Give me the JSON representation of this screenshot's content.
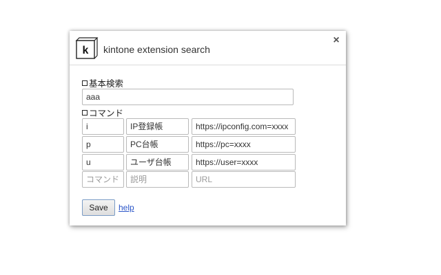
{
  "header": {
    "title": "kintone extension search",
    "logo_letter": "k",
    "close_glyph": "×"
  },
  "basic_search": {
    "label": "基本検索",
    "value": "aaa"
  },
  "commands": {
    "label": "コマンド",
    "rows": [
      {
        "command": "i",
        "description": "IP登録帳",
        "url": "https://ipconfig.com=xxxx"
      },
      {
        "command": "p",
        "description": "PC台帳",
        "url": "https://pc=xxxx"
      },
      {
        "command": "u",
        "description": "ユーザ台帳",
        "url": "https://user=xxxx"
      }
    ],
    "placeholders": {
      "command": "コマンド",
      "description": "説明",
      "url": "URL"
    }
  },
  "actions": {
    "save_label": "Save",
    "help_label": "help"
  },
  "colors": {
    "link": "#2a55c8",
    "button_border": "#7a9cc6"
  }
}
